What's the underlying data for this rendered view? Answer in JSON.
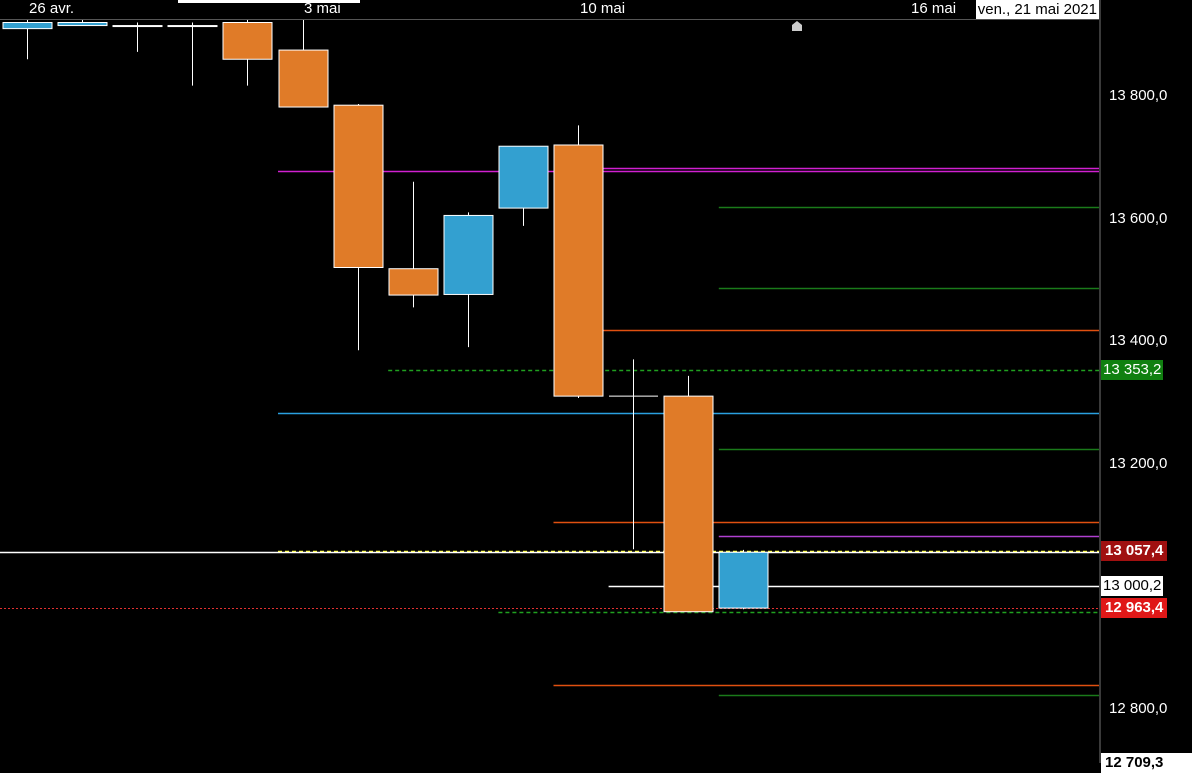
{
  "chart_data": {
    "type": "candlestick",
    "x_axis": {
      "tick_labels": [
        "26 avr.",
        "3 mai",
        "10 mai",
        "16 mai"
      ],
      "current_date": "ven., 21 mai 2021"
    },
    "y_axis": {
      "tick_labels": [
        "13 800,0",
        "13 600,0",
        "13 400,0",
        "13 200,0",
        "12 800,0"
      ],
      "tick_values": [
        13800,
        13600,
        13400,
        13200,
        12800
      ],
      "ylim": [
        12700,
        13925
      ]
    },
    "candles": [
      {
        "date": "26 avr.",
        "open": 13910,
        "high": 13925,
        "low": 13860,
        "close": 13920,
        "color": "#33a0d0"
      },
      {
        "date": "27 avr.",
        "open": 13920,
        "high": 13925,
        "low": 13915,
        "close": 13915,
        "color": "#33a0d0"
      },
      {
        "date": "28 avr.",
        "open": 13915,
        "high": 13920,
        "low": 13872,
        "close": 13915,
        "color": "#33a0d0"
      },
      {
        "date": "29 avr.",
        "open": 13915,
        "high": 13920,
        "low": 13817,
        "close": 13915,
        "color": "#33a0d0"
      },
      {
        "date": "30 avr.",
        "open": 13920,
        "high": 13925,
        "low": 13817,
        "close": 13860,
        "color": "#e07b28"
      },
      {
        "date": "3 mai",
        "open": 13875,
        "high": 13925,
        "low": 13783,
        "close": 13782,
        "color": "#e07b28"
      },
      {
        "date": "4 mai",
        "open": 13785,
        "high": 13787,
        "low": 13385,
        "close": 13520,
        "color": "#e07b28"
      },
      {
        "date": "5 mai",
        "open": 13518,
        "high": 13660,
        "low": 13455,
        "close": 13475,
        "color": "#e07b28"
      },
      {
        "date": "6 mai",
        "open": 13476,
        "high": 13610,
        "low": 13390,
        "close": 13605,
        "color": "#33a0d0"
      },
      {
        "date": "7 mai",
        "open": 13617,
        "high": 13713,
        "low": 13588,
        "close": 13718,
        "color": "#33a0d0"
      },
      {
        "date": "10 mai",
        "open": 13720,
        "high": 13752,
        "low": 13307,
        "close": 13310,
        "color": "#e07b28"
      },
      {
        "date": "11 mai",
        "open": 13310,
        "high": 13370,
        "low": 13060,
        "close": 13310,
        "color": "#ffffff"
      },
      {
        "date": "12 mai",
        "open": 13310,
        "high": 13343,
        "low": 12958,
        "close": 12958,
        "color": "#e07b28"
      },
      {
        "date": "13 mai",
        "open": 12964,
        "high": 13059,
        "low": 12962,
        "close": 13055,
        "color": "#33a0d0"
      }
    ],
    "horizontal_lines": [
      {
        "y": 13677,
        "x_from": "3 mai",
        "color": "#d020d0",
        "style": "solid"
      },
      {
        "y": 13683,
        "x_from": "10 mai",
        "color": "#d020d0",
        "style": "solid"
      },
      {
        "y": 13618,
        "x_from": "13 mai",
        "color": "#1a7a1a",
        "style": "solid"
      },
      {
        "y": 13486,
        "x_from": "13 mai",
        "color": "#1a7a1a",
        "style": "solid"
      },
      {
        "y": 13418,
        "x_from": "10 mai",
        "color": "#e05010",
        "style": "solid"
      },
      {
        "y": 13353.2,
        "x_from": "5 mai",
        "color": "#20a020",
        "style": "dashed"
      },
      {
        "y": 13282,
        "x_from": "3 mai",
        "color": "#2aa0e0",
        "style": "solid"
      },
      {
        "y": 13223,
        "x_from": "13 mai",
        "color": "#1a7a1a",
        "style": "solid"
      },
      {
        "y": 13105,
        "x_from": "10 mai",
        "color": "#e05010",
        "style": "solid"
      },
      {
        "y": 13081,
        "x_from": "13 mai",
        "color": "#b040d0",
        "style": "solid"
      },
      {
        "y": 13057.4,
        "x_from": "3 mai",
        "color": "#ffff30",
        "style": "dashed"
      },
      {
        "y": 13055,
        "x_from": "26 avr.",
        "color": "#ffffff",
        "style": "solid"
      },
      {
        "y": 13000.2,
        "x_from": "11 mai",
        "color": "#ffffff",
        "style": "solid"
      },
      {
        "y": 12963.4,
        "x_from": "26 avr.",
        "color": "#e03030",
        "style": "dotted"
      },
      {
        "y": 12958,
        "x_from": "7 mai",
        "color": "#20a020",
        "style": "dashed"
      },
      {
        "y": 12838,
        "x_from": "10 mai",
        "color": "#e05010",
        "style": "solid"
      },
      {
        "y": 12822,
        "x_from": "13 mai",
        "color": "#1a7a1a",
        "style": "solid"
      }
    ],
    "price_markers": [
      {
        "value_label": "13 353,2",
        "value": 13353.2,
        "bg": "#108010",
        "fg": "#ffffff"
      },
      {
        "value_label": "13 057,4",
        "value": 13057.4,
        "bg": "#a01010",
        "fg": "#ffffff"
      },
      {
        "value_label": "13 000,2",
        "value": 13000.2,
        "bg": "#ffffff",
        "fg": "#000000"
      },
      {
        "value_label": "12 963,4",
        "value": 12963.4,
        "bg": "#e01818",
        "fg": "#ffffff"
      },
      {
        "value_label": "12 709,3",
        "value": 12709.3,
        "bg": "#ffffff",
        "fg": "#000000"
      }
    ],
    "grid": false
  }
}
